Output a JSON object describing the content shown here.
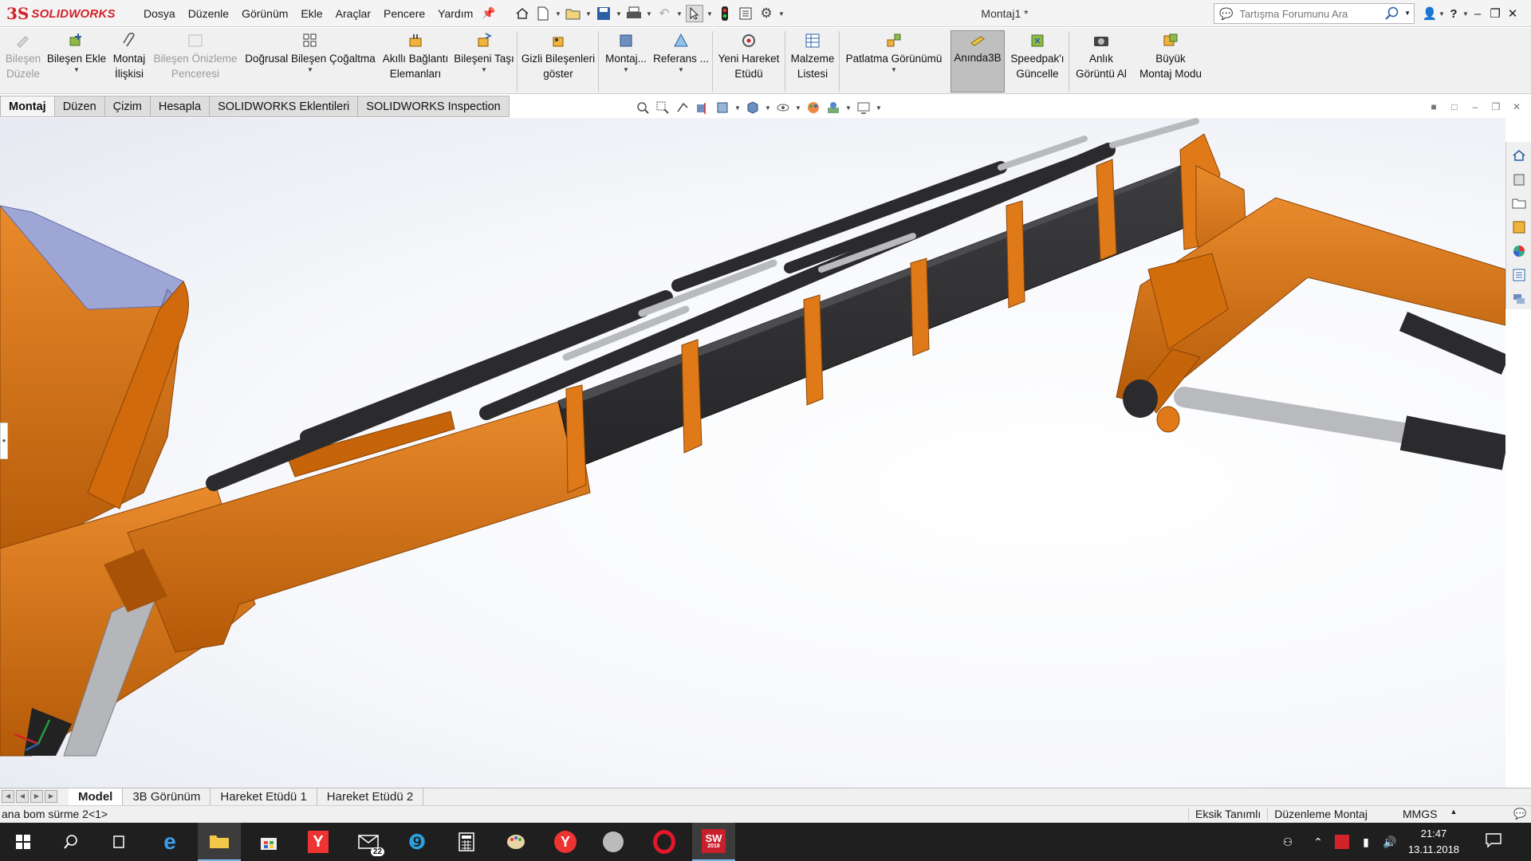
{
  "app": {
    "brand_ds": "3S",
    "brand_word": "SOLIDWORKS"
  },
  "menu": [
    "Dosya",
    "Düzenle",
    "Görünüm",
    "Ekle",
    "Araçlar",
    "Pencere",
    "Yardım"
  ],
  "document_title": "Montaj1 *",
  "search": {
    "placeholder": "Tartışma Forumunu Ara"
  },
  "ribbon": {
    "edit_component": [
      "Bileşen",
      "Düzele"
    ],
    "insert_component": "Bileşen Ekle",
    "mate": [
      "Montaj",
      "İlişkisi"
    ],
    "preview_window": [
      "Bileşen Önizleme",
      "Penceresi"
    ],
    "linear_pattern": "Doğrusal Bileşen Çoğaltma",
    "smart_fasteners": [
      "Akıllı Bağlantı",
      "Elemanları"
    ],
    "move_component": "Bileşeni Taşı",
    "show_hidden": [
      "Gizli Bileşenleri",
      "göster"
    ],
    "assembly_features": "Montaj...",
    "reference_geometry": "Referans ...",
    "new_motion_study": [
      "Yeni Hareket",
      "Etüdü"
    ],
    "bom": [
      "Malzeme",
      "Listesi"
    ],
    "exploded_view": "Patlatma Görünümü",
    "instant3d": "Anında3B",
    "speedpak": [
      "Speedpak'ı",
      "Güncelle"
    ],
    "snapshot": [
      "Anlık",
      "Görüntü Al"
    ],
    "large_assembly": [
      "Büyük",
      "Montaj Modu"
    ]
  },
  "tabs": [
    "Montaj",
    "Düzen",
    "Çizim",
    "Hesapla",
    "SOLIDWORKS Eklentileri",
    "SOLIDWORKS Inspection"
  ],
  "bottom_tabs": [
    "Model",
    "3B Görünüm",
    "Hareket Etüdü 1",
    "Hareket Etüdü 2"
  ],
  "status": {
    "selection": "ana bom sürme 2<1>",
    "definition": "Eksik Tanımlı",
    "mode": "Düzenleme Montaj",
    "units": "MMGS"
  },
  "taskbar": {
    "mail_badge": "22",
    "time": "21:47",
    "date": "13.11.2018",
    "sw_label": "SW",
    "sw_year": "2018"
  },
  "colors": {
    "body_orange": "#d9700f",
    "dark_cylinder": "#2f2f31",
    "brand_red": "#d2232a"
  }
}
